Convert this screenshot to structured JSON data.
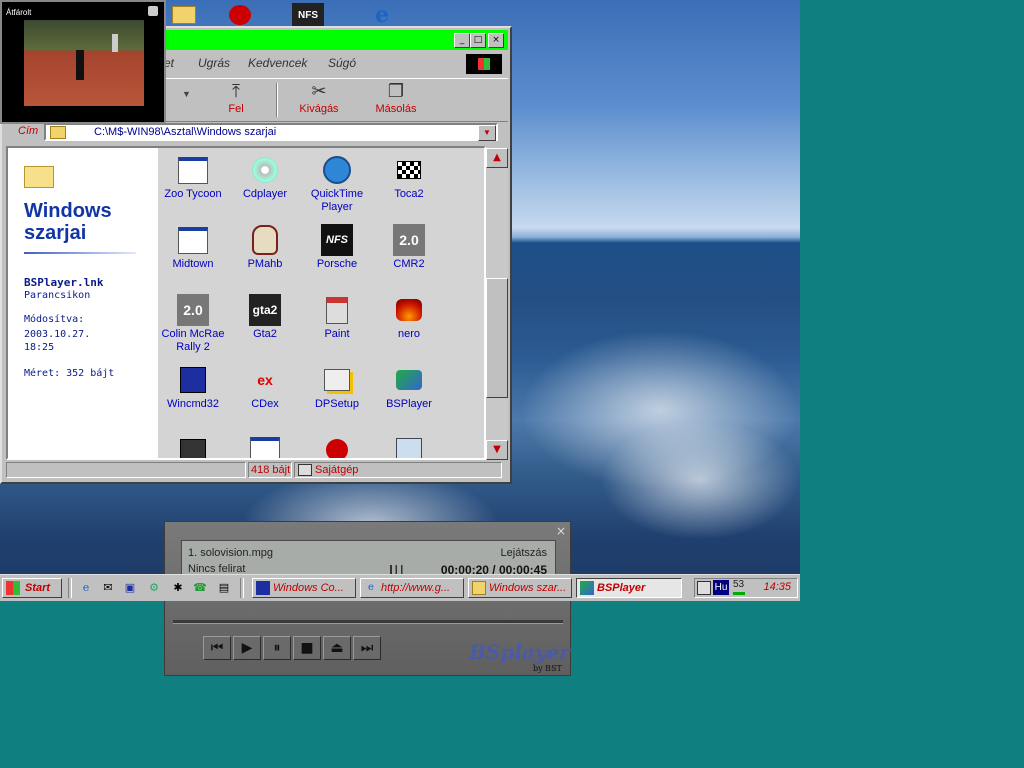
{
  "top_icons": [
    "NFS"
  ],
  "explorer": {
    "title": "",
    "menu": [
      "et",
      "Ugrás",
      "Kedvencek",
      "Súgó"
    ],
    "toolbar": [
      {
        "label": "Fel",
        "icon": "up-folder-icon"
      },
      {
        "label": "Kivágás",
        "icon": "scissors-icon"
      },
      {
        "label": "Másolás",
        "icon": "copy-icon"
      }
    ],
    "address_label": "Cím",
    "address": "C:\\M$-WIN98\\Asztal\\Windows szarjai",
    "left": {
      "title": "Windows szarjai",
      "file_name": "BSPlayer.lnk",
      "file_type": "Parancsikon",
      "modified_label": "Módosítva:",
      "modified_value": "2003.10.27. 18:25",
      "size": "Méret: 352 bájt"
    },
    "icons": [
      {
        "label": "Zoo Tycoon",
        "icon": "window-icon"
      },
      {
        "label": "Cdplayer",
        "icon": "cd-icon"
      },
      {
        "label": "QuickTime Player",
        "icon": "quicktime-icon"
      },
      {
        "label": "Toca2",
        "icon": "flag-icon"
      },
      {
        "label": "Midtown",
        "icon": "window-icon"
      },
      {
        "label": "PMahb",
        "icon": "skull-icon"
      },
      {
        "label": "Porsche",
        "icon": "nfs-icon"
      },
      {
        "label": "CMR2",
        "icon": "2.0"
      },
      {
        "label": "Colin McRae Rally 2",
        "icon": "2.0"
      },
      {
        "label": "Gta2",
        "icon": "gta2"
      },
      {
        "label": "Paint",
        "icon": "paint-icon"
      },
      {
        "label": "nero",
        "icon": "nero-icon"
      },
      {
        "label": "Wincmd32",
        "icon": "floppy-icon"
      },
      {
        "label": "CDex",
        "icon": "ex"
      },
      {
        "label": "DPSetup",
        "icon": "setup-icon"
      },
      {
        "label": "BSPlayer",
        "icon": "bsplayer-icon"
      },
      {
        "label": "",
        "icon": "x-icon"
      },
      {
        "label": "",
        "icon": "window-icon"
      },
      {
        "label": "",
        "icon": "red-icon"
      },
      {
        "label": "",
        "icon": "mp-icon"
      }
    ],
    "status": {
      "size": "418 bájt",
      "location": "Sajátgép"
    }
  },
  "video_overlay": {
    "label": "Átfárolt"
  },
  "bsplayer": {
    "track": "1. solovision.mpg",
    "state": "Lejátszás",
    "subtitle": "Nincs felirat",
    "time": "00:00:20 / 00:00:45",
    "logo": "BSplayer",
    "by": "by BST",
    "controls": [
      "prev",
      "play",
      "pause",
      "stop",
      "eject",
      "next"
    ]
  },
  "taskbar": {
    "start": "Start",
    "tasks": [
      {
        "label": "Windows Co...",
        "icon": "floppy-icon"
      },
      {
        "label": "http://www.g...",
        "icon": "ie-icon"
      },
      {
        "label": "Windows szar...",
        "icon": "folder-icon"
      },
      {
        "label": "BSPlayer",
        "icon": "bsplayer-icon"
      }
    ],
    "lang": "Hu",
    "num": "53",
    "clock": "14:35"
  }
}
